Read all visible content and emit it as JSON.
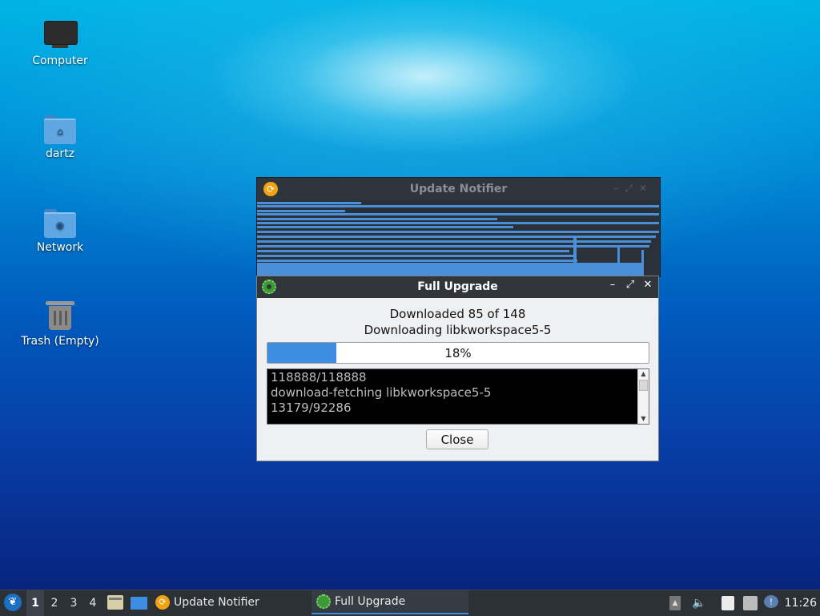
{
  "desktop": {
    "icons": [
      {
        "label": "Computer",
        "icon": "computer-icon"
      },
      {
        "label": "dartz",
        "icon": "home-folder-icon"
      },
      {
        "label": "Network",
        "icon": "network-folder-icon"
      },
      {
        "label": "Trash (Empty)",
        "icon": "trash-icon"
      }
    ]
  },
  "notifier_window": {
    "title": "Update Notifier",
    "icon": "update-notifier-icon"
  },
  "upgrade_window": {
    "title": "Full Upgrade",
    "icon": "gear-icon",
    "status_line1": "Downloaded 85 of 148",
    "status_line2": "Downloading libkworkspace5-5",
    "progress": {
      "value": 18,
      "label": "18%"
    },
    "log_lines": [
      "118888/118888",
      "download-fetching libkworkspace5-5",
      "13179/92286"
    ],
    "close_label": "Close",
    "colors": {
      "titlebar": "#31363b",
      "progress_fill": "#3d8ee2"
    }
  },
  "taskbar": {
    "workspaces": [
      "1",
      "2",
      "3",
      "4"
    ],
    "active_workspace": "1",
    "tasks": [
      {
        "label": "Update Notifier",
        "icon": "update-notifier-icon"
      },
      {
        "label": "Full Upgrade",
        "icon": "gear-icon",
        "active": true
      }
    ],
    "clock": "11:26"
  }
}
